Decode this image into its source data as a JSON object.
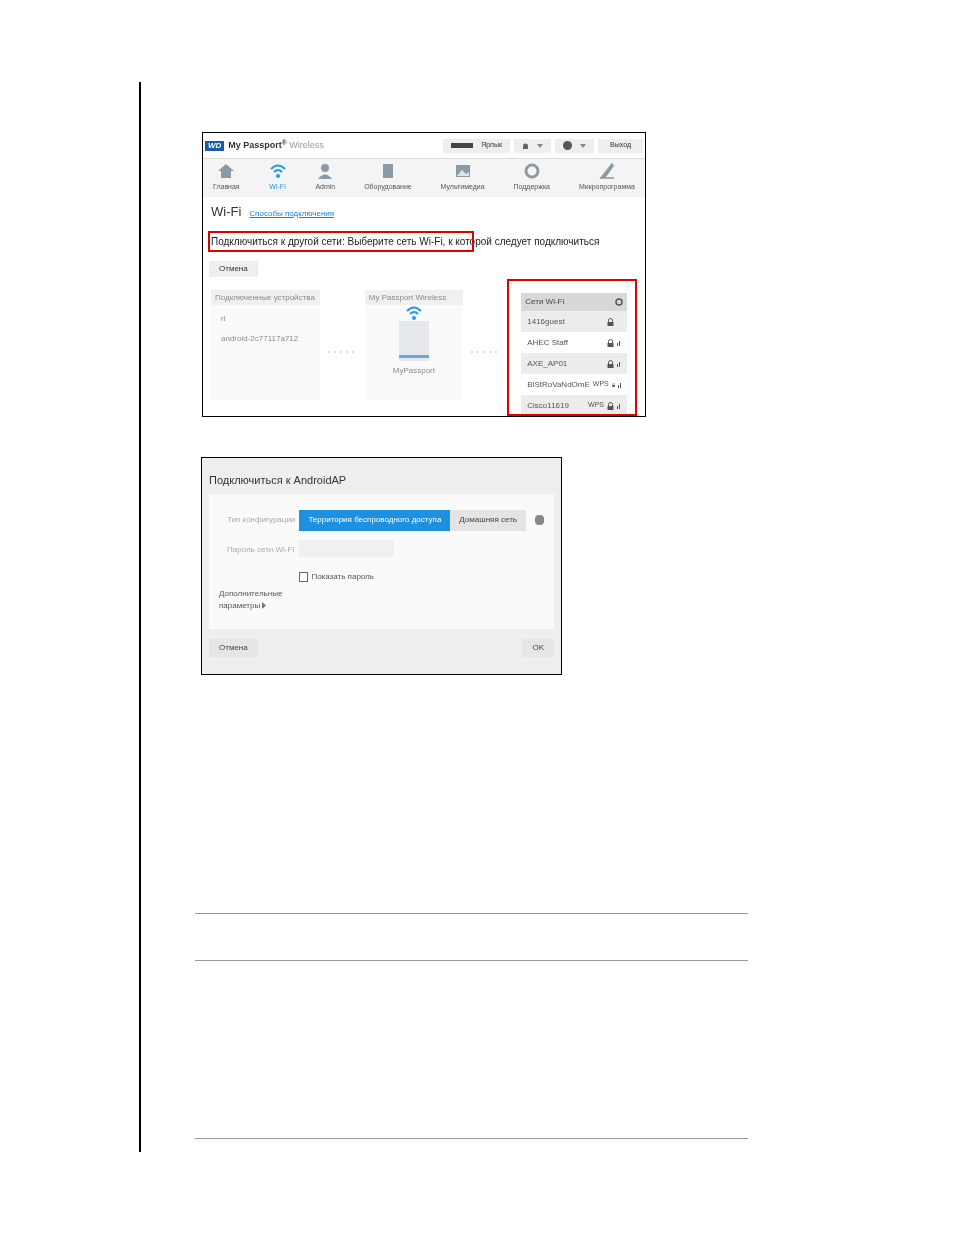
{
  "screenshot_1": {
    "brand": {
      "logo": "WD",
      "product": "My Passport",
      "product_suffix": "Wireless",
      "trademark": "®"
    },
    "header_buttons": [
      {
        "kind": "shortcut",
        "label": "Ярлык"
      },
      {
        "kind": "bell"
      },
      {
        "kind": "help"
      },
      {
        "kind": "text",
        "label": "Выход"
      }
    ],
    "nav": [
      {
        "label": "Главная",
        "selected": false
      },
      {
        "label": "Wi-Fi",
        "selected": true
      },
      {
        "label": "Admin",
        "selected": false
      },
      {
        "label": "Оборудование",
        "selected": false
      },
      {
        "label": "Мультимедиа",
        "selected": false
      },
      {
        "label": "Поддержка",
        "selected": false
      },
      {
        "label": "Микропрограмма",
        "selected": false
      }
    ],
    "title": "Wi-Fi",
    "title_link": "Способы подключения",
    "message": "Подключиться к другой сети: Выберите сеть Wi-Fi, к которой следует подключиться",
    "message_highlighted": true,
    "cancel": "Отмена",
    "devices_panel": {
      "title": "Подключенные устройства",
      "items": [
        "ri",
        "android-2c77117a712"
      ]
    },
    "device_panel": {
      "title": "My Passport Wireless",
      "device_label": "MyPassport"
    },
    "wifi_panel": {
      "title": "Сети Wi-Fi",
      "highlighted": true,
      "networks": [
        {
          "name": "1416guest",
          "signal": false,
          "selected": true
        },
        {
          "name": "AHEC Staff",
          "signal": true,
          "selected": false
        },
        {
          "name": "AXE_AP01",
          "signal": true,
          "selected": true
        },
        {
          "name": "BlStRoVaNdOmE",
          "wps_label": "WPS",
          "signal": true,
          "selected": false
        },
        {
          "name": "Cisco11619",
          "wps_label": "WPS",
          "signal": true,
          "selected": true
        }
      ]
    }
  },
  "screenshot_2": {
    "title": "Подключиться к AndroidAP",
    "config_label": "Тип конфигурации",
    "config_options": [
      {
        "label": "Территория беспроводного доступа",
        "selected": true
      },
      {
        "label": "Домашняя сеть",
        "selected": false
      }
    ],
    "password_label": "Пароль сети Wi-Fi",
    "show_password": {
      "label": "Показать пароль",
      "checked": false
    },
    "advanced": "Дополнительные параметры",
    "cancel": "Отмена",
    "ok": "OK"
  }
}
